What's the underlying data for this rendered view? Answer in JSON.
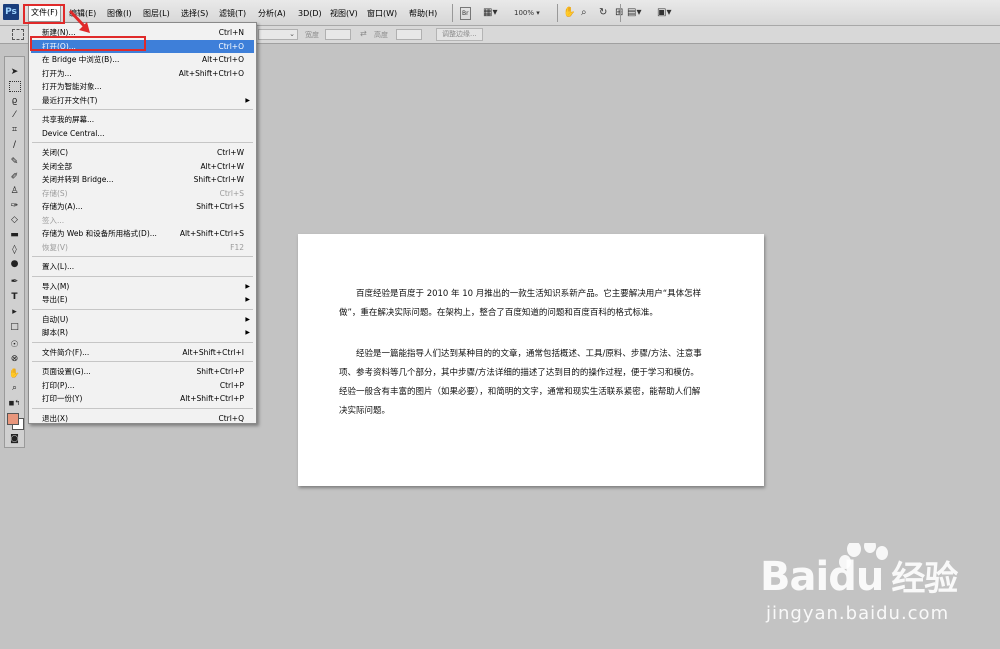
{
  "app": {
    "logo": "Ps"
  },
  "menubar": {
    "items": [
      "文件(F)",
      "编辑(E)",
      "图像(I)",
      "图层(L)",
      "选择(S)",
      "滤镜(T)",
      "分析(A)",
      "3D(D)",
      "视图(V)",
      "窗口(W)",
      "帮助(H)"
    ],
    "active": "文件(F)",
    "zoom": "100%",
    "bridge_icon": "Br"
  },
  "options_bar": {
    "width_label": "宽度",
    "height_label": "高度",
    "refine_button": "调整边缘..."
  },
  "file_menu": {
    "groups": [
      [
        {
          "label": "新建(N)...",
          "shortcut": "Ctrl+N"
        },
        {
          "label": "打开(O)...",
          "shortcut": "Ctrl+O",
          "selected": true
        },
        {
          "label": "在 Bridge 中浏览(B)...",
          "shortcut": "Alt+Ctrl+O"
        },
        {
          "label": "打开为...",
          "shortcut": "Alt+Shift+Ctrl+O"
        },
        {
          "label": "打开为智能对象..."
        },
        {
          "label": "最近打开文件(T)",
          "submenu": true
        }
      ],
      [
        {
          "label": "共享我的屏幕..."
        },
        {
          "label": "Device Central..."
        }
      ],
      [
        {
          "label": "关闭(C)",
          "shortcut": "Ctrl+W"
        },
        {
          "label": "关闭全部",
          "shortcut": "Alt+Ctrl+W"
        },
        {
          "label": "关闭并转到 Bridge...",
          "shortcut": "Shift+Ctrl+W"
        },
        {
          "label": "存储(S)",
          "shortcut": "Ctrl+S",
          "disabled": true
        },
        {
          "label": "存储为(A)...",
          "shortcut": "Shift+Ctrl+S"
        },
        {
          "label": "签入...",
          "disabled": true
        },
        {
          "label": "存储为 Web 和设备所用格式(D)...",
          "shortcut": "Alt+Shift+Ctrl+S"
        },
        {
          "label": "恢复(V)",
          "shortcut": "F12",
          "disabled": true
        }
      ],
      [
        {
          "label": "置入(L)..."
        }
      ],
      [
        {
          "label": "导入(M)",
          "submenu": true
        },
        {
          "label": "导出(E)",
          "submenu": true
        }
      ],
      [
        {
          "label": "自动(U)",
          "submenu": true
        },
        {
          "label": "脚本(R)",
          "submenu": true
        }
      ],
      [
        {
          "label": "文件简介(F)...",
          "shortcut": "Alt+Shift+Ctrl+I"
        }
      ],
      [
        {
          "label": "页面设置(G)...",
          "shortcut": "Shift+Ctrl+P"
        },
        {
          "label": "打印(P)...",
          "shortcut": "Ctrl+P"
        },
        {
          "label": "打印一份(Y)",
          "shortcut": "Alt+Shift+Ctrl+P"
        }
      ],
      [
        {
          "label": "退出(X)",
          "shortcut": "Ctrl+Q"
        }
      ]
    ]
  },
  "document": {
    "paragraphs": [
      "百度经验是百度于 2010 年 10 月推出的一款生活知识系新产品。它主要解决用户“具体怎样做”，重在解决实际问题。在架构上，整合了百度知道的问题和百度百科的格式标准。",
      "经验是一篇能指导人们达到某种目的的文章，通常包括概述、工具/原料、步骤/方法、注意事项、参考资料等几个部分，其中步骤/方法详细的描述了达到目的的操作过程，便于学习和模仿。经验一般含有丰富的图片（如果必要），和简明的文字，通常和现实生活联系紧密，能帮助人们解决实际问题。"
    ]
  },
  "watermark": {
    "brand": "Baidu",
    "product": "经验",
    "url": "jingyan.baidu.com"
  },
  "colors": {
    "highlight": "#3e7fd9",
    "annotation_red": "#e02a2a",
    "foreground_swatch": "#e8967c"
  }
}
